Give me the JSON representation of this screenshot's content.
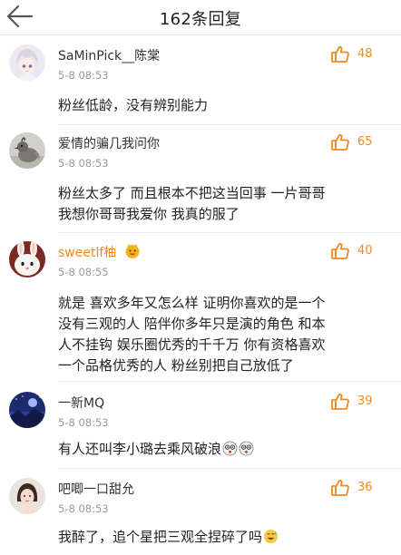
{
  "header": {
    "title": "162条回复"
  },
  "colors": {
    "accent": "#f08a1c",
    "text": "#222222",
    "muted": "#9a9a9a",
    "divider": "#ececec"
  },
  "comments": [
    {
      "username": "SaMinPick__陈棠",
      "timestamp": "5-8 08:53",
      "likes": "48",
      "text_lines": [
        "粉丝低龄，没有辨别能力"
      ],
      "avatar_icon": "anime-girl-avatar"
    },
    {
      "username": "爱情的骗几我问你",
      "timestamp": "5-8 08:53",
      "likes": "65",
      "text_lines": [
        "粉丝太多了 而且根本不把这当回事 一片哥哥",
        "我想你哥哥我爱你 我真的服了"
      ],
      "avatar_icon": "bird-avatar"
    },
    {
      "username": "sweetlf柚",
      "timestamp": "5-8 08:55",
      "likes": "40",
      "text_lines": [
        "就是 喜欢多年又怎么样 证明你喜欢的是一个",
        "没有三观的人 陪伴你多年只是演的角色 和本",
        "人不挂钩 娱乐圈优秀的千千万 你有资格喜欢",
        "一个品格优秀的人 粉丝别把自己放低了"
      ],
      "avatar_icon": "bunny-avatar",
      "badge_icon": "member-badge-icon"
    },
    {
      "username": "一新MQ",
      "timestamp": "5-8 08:53",
      "likes": "39",
      "text_lines": [
        "有人还叫李小璐去乘风破浪"
      ],
      "avatar_icon": "night-scene-avatar",
      "emojis": [
        "dizzy-face-icon",
        "dizzy-face-icon"
      ]
    },
    {
      "username": "吧唧一口甜允",
      "timestamp": "5-8 08:53",
      "likes": "36",
      "text_lines": [
        "我醉了，追个星把三观全捏碎了吗"
      ],
      "avatar_icon": "girl-photo-avatar",
      "emojis": [
        "sweat-smile-icon"
      ]
    }
  ]
}
